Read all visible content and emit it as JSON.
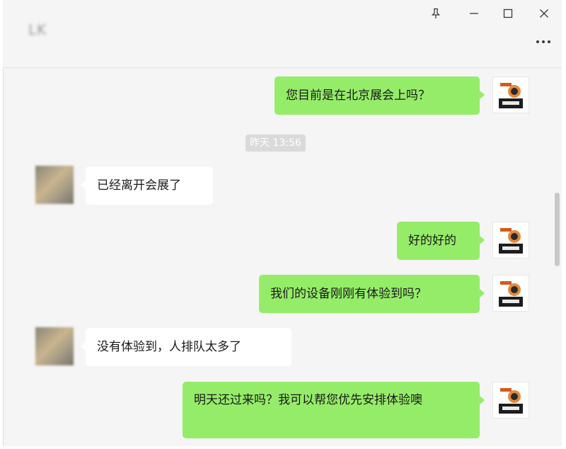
{
  "header": {
    "contact_name": "LK",
    "pin_icon": "pin-icon",
    "minimize_icon": "minimize-icon",
    "maximize_icon": "maximize-icon",
    "close_icon": "close-icon",
    "more_icon": "more-icon"
  },
  "timestamp": "昨天 13:56",
  "messages": [
    {
      "direction": "out",
      "text": "您目前是在北京展会上吗？"
    },
    {
      "direction": "in",
      "text": "已经离开会展了"
    },
    {
      "direction": "out",
      "text": "好的好的"
    },
    {
      "direction": "out",
      "text": "我们的设备刚刚有体验到吗？"
    },
    {
      "direction": "in",
      "text": "没有体验到，人排队太多了"
    },
    {
      "direction": "out",
      "text": "明天还过来吗？我可以帮您优先安排体验噢"
    }
  ],
  "colors": {
    "outgoing_bubble": "#95ec69",
    "incoming_bubble": "#ffffff",
    "background": "#f5f5f5"
  }
}
